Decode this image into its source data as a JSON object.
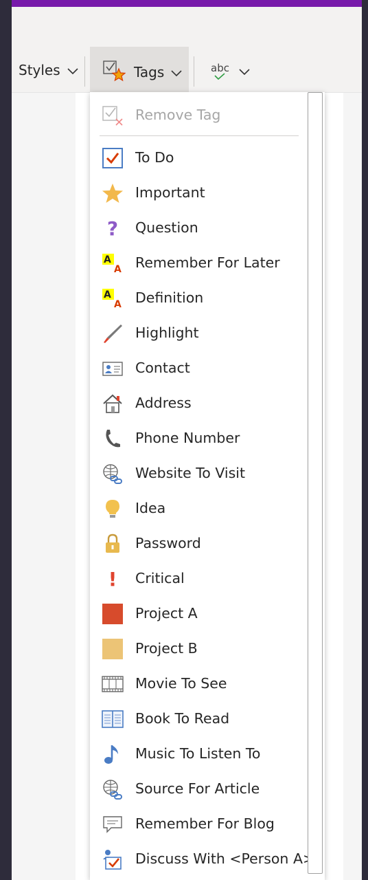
{
  "ribbon": {
    "styles_label": "Styles",
    "tags_label": "Tags",
    "spelling_label": "abc"
  },
  "colors": {
    "accent": "#7719aa",
    "todo_check": "#d83b01",
    "star": "#f2b84b",
    "question": "#8e5bc7",
    "critical": "#e0442f",
    "project_a": "#d74b2c",
    "project_b": "#ecc476",
    "blue_icon": "#4a7cc4"
  },
  "menu": {
    "remove_tag": "Remove Tag",
    "items": [
      {
        "label": "To Do",
        "icon": "todo-checkbox-icon"
      },
      {
        "label": "Important",
        "icon": "star-icon"
      },
      {
        "label": "Question",
        "icon": "question-icon"
      },
      {
        "label": "Remember For Later",
        "icon": "highlight-letters-icon"
      },
      {
        "label": "Definition",
        "icon": "highlight-letters-icon"
      },
      {
        "label": "Highlight",
        "icon": "pen-icon"
      },
      {
        "label": "Contact",
        "icon": "contact-card-icon"
      },
      {
        "label": "Address",
        "icon": "house-icon"
      },
      {
        "label": "Phone Number",
        "icon": "phone-icon"
      },
      {
        "label": "Website To Visit",
        "icon": "globe-link-icon"
      },
      {
        "label": "Idea",
        "icon": "lightbulb-icon"
      },
      {
        "label": "Password",
        "icon": "lock-icon"
      },
      {
        "label": "Critical",
        "icon": "exclamation-icon"
      },
      {
        "label": "Project A",
        "icon": "red-square-icon"
      },
      {
        "label": "Project B",
        "icon": "yellow-square-icon"
      },
      {
        "label": "Movie To See",
        "icon": "film-icon"
      },
      {
        "label": "Book To Read",
        "icon": "book-icon"
      },
      {
        "label": "Music To Listen To",
        "icon": "music-note-icon"
      },
      {
        "label": "Source For Article",
        "icon": "globe-link-icon"
      },
      {
        "label": "Remember For Blog",
        "icon": "speech-bubble-icon"
      },
      {
        "label": "Discuss With <Person A>",
        "icon": "person-check-icon"
      }
    ]
  }
}
